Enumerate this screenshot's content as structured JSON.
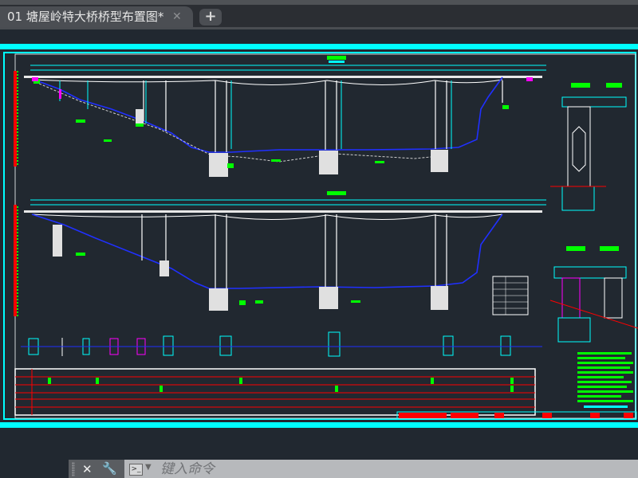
{
  "tabs": [
    {
      "label": "01 塘屋岭特大桥桥型布置图*",
      "active": true
    }
  ],
  "tab_close_glyph": "✕",
  "tab_add_glyph": "+",
  "command_line": {
    "placeholder": "键入命令",
    "close_glyph": "✕",
    "customize_glyph": "🔧",
    "prompt_glyph": ">_"
  },
  "colors": {
    "background": "#212830",
    "frame": "#00ffff",
    "green": "#00ff00",
    "red": "#ff0000",
    "blue": "#0000ff",
    "magenta": "#ff00ff"
  }
}
